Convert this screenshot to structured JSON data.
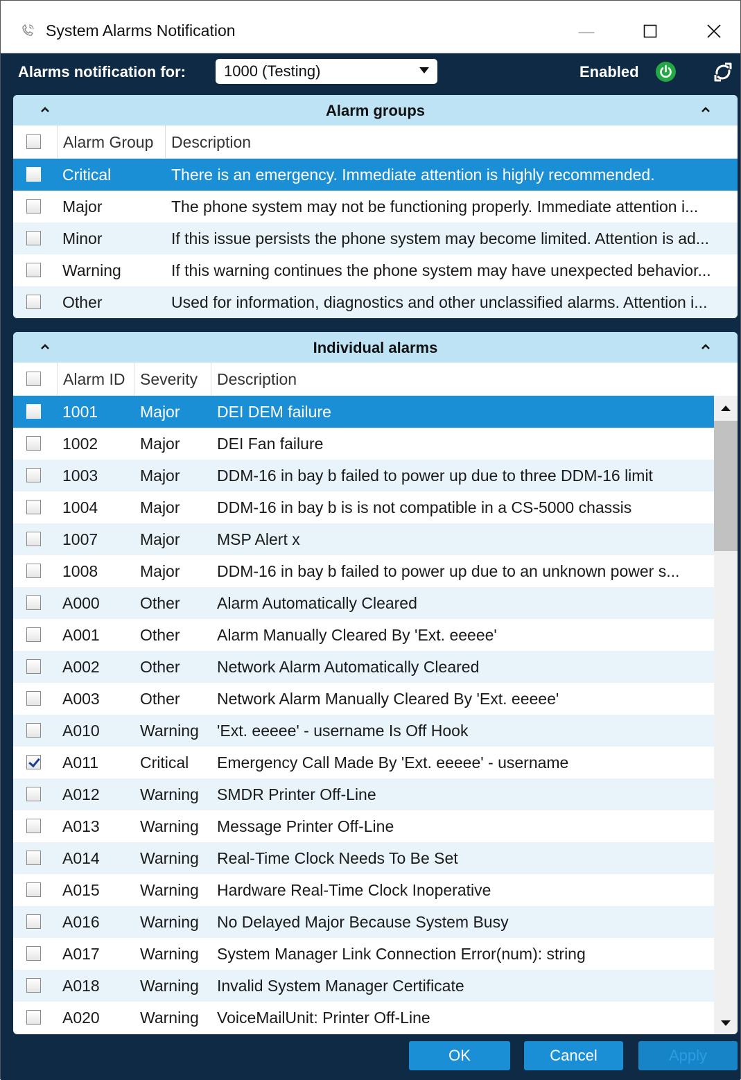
{
  "window": {
    "title": "System Alarms Notification",
    "min_glyph": "—",
    "max_glyph": "☐",
    "close_glyph": "✕"
  },
  "toolbar": {
    "label": "Alarms notification for:",
    "selected": "1000 (Testing)",
    "status_label": "Enabled",
    "status_color": "#22a844",
    "power_icon": "power-icon",
    "refresh_icon": "refresh-icon"
  },
  "groups": {
    "title": "Alarm groups",
    "headers": [
      "Alarm Group",
      "Description"
    ],
    "rows": [
      {
        "checked": false,
        "selected": true,
        "group": "Critical",
        "desc": "There is an emergency. Immediate attention is highly recommended."
      },
      {
        "checked": false,
        "selected": false,
        "group": "Major",
        "desc": "The phone system may not be functioning properly. Immediate attention i..."
      },
      {
        "checked": false,
        "selected": false,
        "group": "Minor",
        "desc": "If this issue persists the phone system may become limited. Attention is ad..."
      },
      {
        "checked": false,
        "selected": false,
        "group": "Warning",
        "desc": "If this warning continues the phone system may have unexpected behavior..."
      },
      {
        "checked": false,
        "selected": false,
        "group": "Other",
        "desc": "Used for information, diagnostics and other unclassified alarms. Attention i..."
      }
    ]
  },
  "alarms": {
    "title": "Individual alarms",
    "headers": [
      "Alarm ID",
      "Severity",
      "Description"
    ],
    "rows": [
      {
        "checked": false,
        "selected": true,
        "id": "1001",
        "severity": "Major",
        "desc": "DEI DEM failure"
      },
      {
        "checked": false,
        "selected": false,
        "id": "1002",
        "severity": "Major",
        "desc": "DEI Fan failure"
      },
      {
        "checked": false,
        "selected": false,
        "id": "1003",
        "severity": "Major",
        "desc": "DDM-16 in bay b failed to power up due to three DDM-16 limit"
      },
      {
        "checked": false,
        "selected": false,
        "id": "1004",
        "severity": "Major",
        "desc": "DDM-16 in bay b is is not compatible in a CS-5000 chassis"
      },
      {
        "checked": false,
        "selected": false,
        "id": "1007",
        "severity": "Major",
        "desc": "MSP Alert x"
      },
      {
        "checked": false,
        "selected": false,
        "id": "1008",
        "severity": "Major",
        "desc": "DDM-16 in bay b failed to power up due to an unknown power s..."
      },
      {
        "checked": false,
        "selected": false,
        "id": "A000",
        "severity": "Other",
        "desc": "Alarm Automatically Cleared"
      },
      {
        "checked": false,
        "selected": false,
        "id": "A001",
        "severity": "Other",
        "desc": "Alarm Manually Cleared By 'Ext. eeeee'"
      },
      {
        "checked": false,
        "selected": false,
        "id": "A002",
        "severity": "Other",
        "desc": "Network Alarm Automatically Cleared"
      },
      {
        "checked": false,
        "selected": false,
        "id": "A003",
        "severity": "Other",
        "desc": "Network Alarm Manually Cleared By 'Ext. eeeee'"
      },
      {
        "checked": false,
        "selected": false,
        "id": "A010",
        "severity": "Warning",
        "desc": "'Ext. eeeee' - username Is Off Hook"
      },
      {
        "checked": true,
        "selected": false,
        "id": "A011",
        "severity": "Critical",
        "desc": "Emergency Call Made By 'Ext. eeeee' - username"
      },
      {
        "checked": false,
        "selected": false,
        "id": "A012",
        "severity": "Warning",
        "desc": "SMDR Printer Off-Line"
      },
      {
        "checked": false,
        "selected": false,
        "id": "A013",
        "severity": "Warning",
        "desc": "Message Printer Off-Line"
      },
      {
        "checked": false,
        "selected": false,
        "id": "A014",
        "severity": "Warning",
        "desc": "Real-Time Clock Needs To Be Set"
      },
      {
        "checked": false,
        "selected": false,
        "id": "A015",
        "severity": "Warning",
        "desc": "Hardware Real-Time Clock Inoperative"
      },
      {
        "checked": false,
        "selected": false,
        "id": "A016",
        "severity": "Warning",
        "desc": "No Delayed Major Because System Busy"
      },
      {
        "checked": false,
        "selected": false,
        "id": "A017",
        "severity": "Warning",
        "desc": "System Manager Link Connection Error(num): string"
      },
      {
        "checked": false,
        "selected": false,
        "id": "A018",
        "severity": "Warning",
        "desc": "Invalid System Manager Certificate"
      },
      {
        "checked": false,
        "selected": false,
        "id": "A020",
        "severity": "Warning",
        "desc": "VoiceMailUnit: Printer Off-Line"
      }
    ]
  },
  "footer": {
    "ok": "OK",
    "cancel": "Cancel",
    "apply": "Apply"
  }
}
